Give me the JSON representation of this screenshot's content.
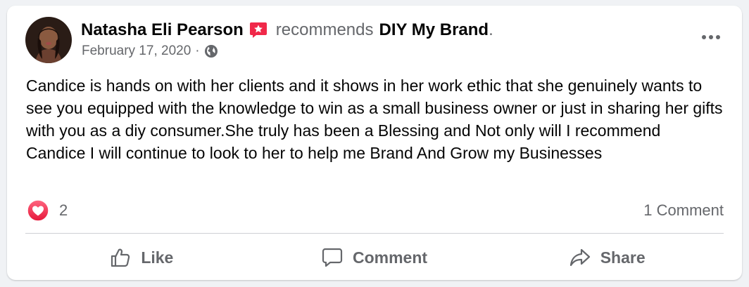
{
  "post": {
    "author": "Natasha Eli Pearson",
    "verb": "recommends",
    "page": "DIY My Brand",
    "period": ".",
    "date": "February 17, 2020",
    "separator": "·",
    "audience_icon": "globe-icon",
    "body": "Candice is hands on with her clients and it shows in her work ethic that she genuinely wants to see you equipped with the knowledge to win as a small business owner or just in sharing her gifts with you as a diy consumer.She truly has been a Blessing and Not only will I recommend Candice I will continue to look to her to help me Brand And Grow my Businesses"
  },
  "stats": {
    "reaction_count": "2",
    "comments": "1 Comment"
  },
  "actions": {
    "like": "Like",
    "comment": "Comment",
    "share": "Share"
  },
  "colors": {
    "recommend_icon": "#f02849",
    "heart": "#f33e58",
    "secondary_text": "#65676b",
    "card_background": "#ffffff"
  }
}
